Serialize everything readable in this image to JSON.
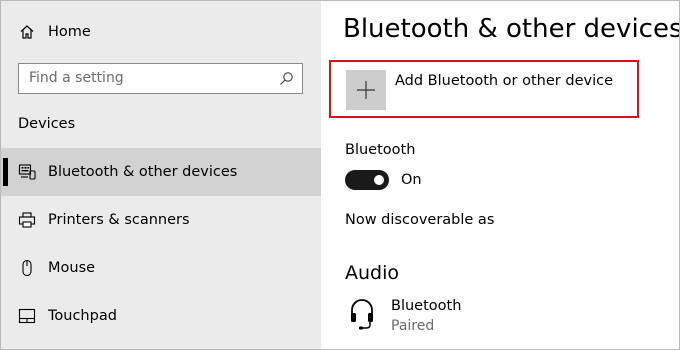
{
  "sidebar": {
    "home_label": "Home",
    "search_placeholder": "Find a setting",
    "section_title": "Devices",
    "items": [
      {
        "label": "Bluetooth & other devices",
        "icon": "keyboard-devices-icon",
        "selected": true
      },
      {
        "label": "Printers & scanners",
        "icon": "printer-icon",
        "selected": false
      },
      {
        "label": "Mouse",
        "icon": "mouse-icon",
        "selected": false
      },
      {
        "label": "Touchpad",
        "icon": "touchpad-icon",
        "selected": false
      }
    ]
  },
  "main": {
    "title": "Bluetooth & other devices",
    "add_device_label": "Add Bluetooth or other device",
    "bluetooth_label": "Bluetooth",
    "bluetooth_toggle_state": "On",
    "discoverable_text": "Now discoverable as",
    "audio_section_title": "Audio",
    "audio_devices": [
      {
        "name": "Bluetooth",
        "status": "Paired",
        "icon": "headset-icon"
      }
    ]
  },
  "colors": {
    "sidebar_bg": "#ebebeb",
    "selected_bg": "#d2d2d2",
    "highlight_border": "#e0101a",
    "toggle_on": "#1a1a1a"
  }
}
